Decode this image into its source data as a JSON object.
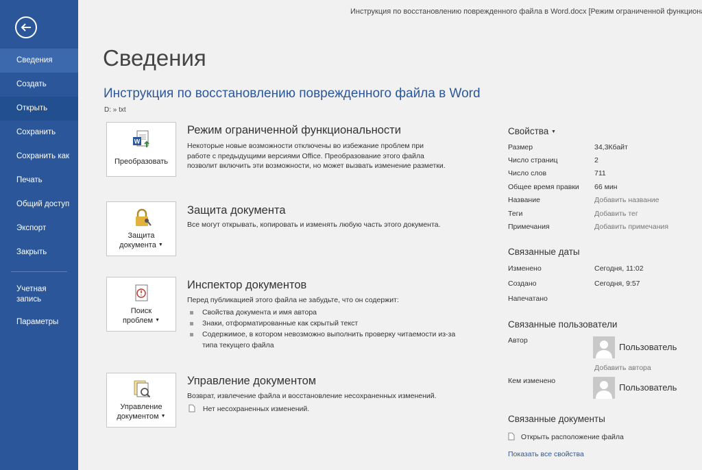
{
  "window": {
    "title": "Инструкция по восстановлению поврежденного файла в Word.docx [Режим ограниченной функциональности]"
  },
  "sidebar": {
    "items": [
      {
        "label": "Сведения"
      },
      {
        "label": "Создать"
      },
      {
        "label": "Открыть"
      },
      {
        "label": "Сохранить"
      },
      {
        "label": "Сохранить как"
      },
      {
        "label": "Печать"
      },
      {
        "label": "Общий доступ"
      },
      {
        "label": "Экспорт"
      },
      {
        "label": "Закрыть"
      }
    ],
    "account_line1": "Учетная",
    "account_line2": "запись",
    "params": "Параметры"
  },
  "main": {
    "page_title": "Сведения",
    "doc_title": "Инструкция по восстановлению поврежденного файла в Word",
    "doc_path": "D: » txt",
    "sections": {
      "compat": {
        "button": "Преобразовать",
        "heading": "Режим ограниченной функциональности",
        "text": "Некоторые новые возможности отключены во избежание проблем при работе с предыдущими версиями Office. Преобразование этого файла позволит включить эти возможности, но может вызвать изменение разметки."
      },
      "protect": {
        "button_line1": "Защита",
        "button_line2": "документа",
        "heading": "Защита документа",
        "text": "Все могут открывать, копировать и изменять любую часть этого документа."
      },
      "inspect": {
        "button_line1": "Поиск",
        "button_line2": "проблем",
        "heading": "Инспектор документов",
        "text": "Перед публикацией этого файла не забудьте, что он содержит:",
        "bullets": [
          "Свойства документа и имя автора",
          "Знаки, отформатированные как скрытый текст",
          "Содержимое, в котором невозможно выполнить проверку читаемости из-за типа текущего файла"
        ]
      },
      "manage": {
        "button_line1": "Управление",
        "button_line2": "документом",
        "heading": "Управление документом",
        "text": "Возврат, извлечение файла и восстановление несохраненных изменений.",
        "sub": "Нет несохраненных изменений."
      }
    }
  },
  "properties": {
    "heading": "Свойства",
    "rows": [
      {
        "key": "Размер",
        "value": "34,3Кбайт"
      },
      {
        "key": "Число страниц",
        "value": "2"
      },
      {
        "key": "Число слов",
        "value": "711"
      },
      {
        "key": "Общее время правки",
        "value": "66 мин"
      },
      {
        "key": "Название",
        "value": "Добавить название"
      },
      {
        "key": "Теги",
        "value": "Добавить тег"
      },
      {
        "key": "Примечания",
        "value": "Добавить примечания"
      }
    ]
  },
  "dates": {
    "heading": "Связанные даты",
    "rows": [
      {
        "key": "Изменено",
        "value": "Сегодня, 11:02"
      },
      {
        "key": "Создано",
        "value": "Сегодня, 9:57"
      },
      {
        "key": "Напечатано",
        "value": ""
      }
    ]
  },
  "people": {
    "heading": "Связанные пользователи",
    "author_label": "Автор",
    "author_name": "Пользователь",
    "add_author": "Добавить автора",
    "modified_label": "Кем изменено",
    "modified_name": "Пользователь"
  },
  "docs": {
    "heading": "Связанные документы",
    "open_location": "Открыть расположение файла",
    "show_all": "Показать все свойства"
  }
}
